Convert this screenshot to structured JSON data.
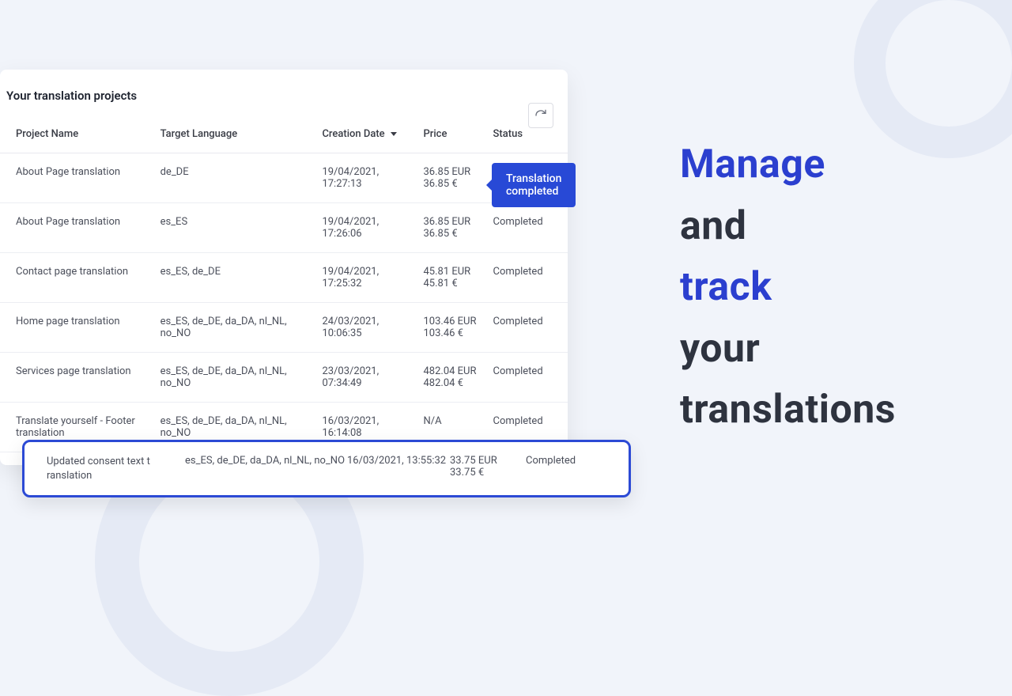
{
  "panel": {
    "title": "Your translation projects",
    "columns": {
      "project": "Project Name",
      "language": "Target Language",
      "date": "Creation Date",
      "price": "Price",
      "status": "Status"
    },
    "rows": [
      {
        "name": "About Page translation",
        "lang": "de_DE",
        "date": "19/04/2021, 17:27:13",
        "price1": "36.85 EUR",
        "price2": "36.85 €",
        "status": ""
      },
      {
        "name": "About Page translation",
        "lang": "es_ES",
        "date": "19/04/2021, 17:26:06",
        "price1": "36.85 EUR",
        "price2": "36.85 €",
        "status": "Completed"
      },
      {
        "name": "Contact page translation",
        "lang": "es_ES, de_DE",
        "date": "19/04/2021, 17:25:32",
        "price1": "45.81 EUR",
        "price2": "45.81 €",
        "status": "Completed"
      },
      {
        "name": "Home page translation",
        "lang": "es_ES, de_DE, da_DA, nl_NL, no_NO",
        "date": "24/03/2021, 10:06:35",
        "price1": "103.46 EUR",
        "price2": "103.46 €",
        "status": "Completed"
      },
      {
        "name": "Services page translation",
        "lang": "es_ES, de_DE, da_DA, nl_NL, no_NO",
        "date": "23/03/2021, 07:34:49",
        "price1": "482.04 EUR",
        "price2": "482.04 €",
        "status": "Completed"
      },
      {
        "name": "Translate yourself - Footer translation",
        "lang": "es_ES, de_DE, da_DA, nl_NL, no_NO",
        "date": "16/03/2021, 16:14:08",
        "price1": "N/A",
        "price2": "",
        "status": "Completed"
      }
    ]
  },
  "badge": {
    "text": "Translation completed"
  },
  "highlight": {
    "name": "Updated consent text t\nranslation",
    "lang": "es_ES, de_DE, da_DA, nl_NL, no_NO",
    "date": "16/03/2021, 13:55:32",
    "price1": "33.75 EUR",
    "price2": "33.75 €",
    "status": "Completed"
  },
  "headline": {
    "w1": "Manage",
    "w2": "and",
    "w3": "track",
    "w4": "your",
    "w5": "translations"
  }
}
